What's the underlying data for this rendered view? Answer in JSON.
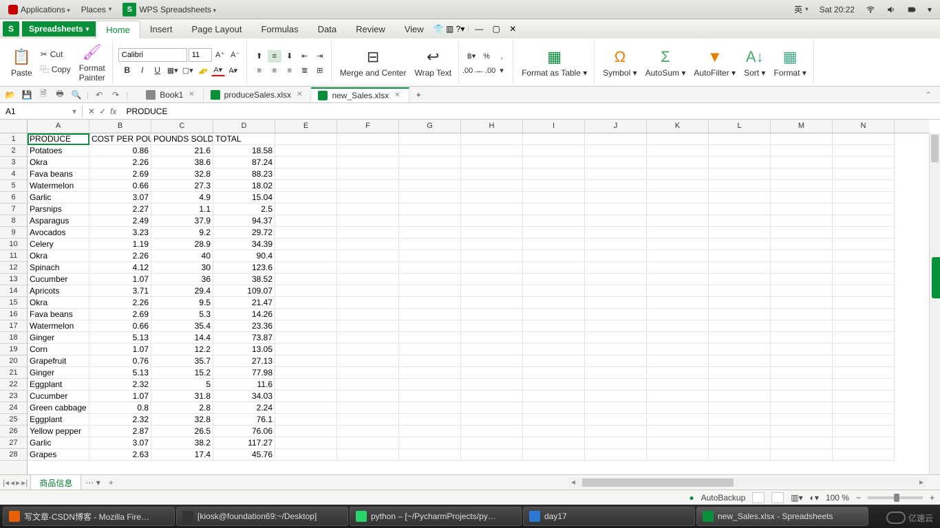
{
  "gnome": {
    "applications": "Applications",
    "places": "Places",
    "wps": "WPS Spreadsheets",
    "ime": "英",
    "clock": "Sat 20:22"
  },
  "app": {
    "title": "Spreadsheets"
  },
  "ribbon_tabs": [
    "Home",
    "Insert",
    "Page Layout",
    "Formulas",
    "Data",
    "Review",
    "View"
  ],
  "ribbon": {
    "paste": "Paste",
    "cut": "Cut",
    "copy": "Copy",
    "format_painter": "Format\nPainter",
    "font_name": "Calibri",
    "font_size": "11",
    "merge": "Merge and Center",
    "wrap": "Wrap Text",
    "format_table": "Format as Table",
    "symbol": "Symbol",
    "autosum": "AutoSum",
    "autofilter": "AutoFilter",
    "sort": "Sort",
    "format": "Format"
  },
  "doc_tabs": [
    {
      "label": "Book1",
      "active": false
    },
    {
      "label": "produceSales.xlsx",
      "active": false
    },
    {
      "label": "new_Sales.xlsx",
      "active": true
    }
  ],
  "namebox": "A1",
  "formula": "PRODUCE",
  "columns": [
    "A",
    "B",
    "C",
    "D",
    "E",
    "F",
    "G",
    "H",
    "I",
    "J",
    "K",
    "L",
    "M",
    "N"
  ],
  "rows": [
    [
      "PRODUCE",
      "COST PER POUND",
      "POUNDS SOLD",
      "TOTAL"
    ],
    [
      "Potatoes",
      "0.86",
      "21.6",
      "18.58"
    ],
    [
      "Okra",
      "2.26",
      "38.6",
      "87.24"
    ],
    [
      "Fava beans",
      "2.69",
      "32.8",
      "88.23"
    ],
    [
      "Watermelon",
      "0.66",
      "27.3",
      "18.02"
    ],
    [
      "Garlic",
      "3.07",
      "4.9",
      "15.04"
    ],
    [
      "Parsnips",
      "2.27",
      "1.1",
      "2.5"
    ],
    [
      "Asparagus",
      "2.49",
      "37.9",
      "94.37"
    ],
    [
      "Avocados",
      "3.23",
      "9.2",
      "29.72"
    ],
    [
      "Celery",
      "1.19",
      "28.9",
      "34.39"
    ],
    [
      "Okra",
      "2.26",
      "40",
      "90.4"
    ],
    [
      "Spinach",
      "4.12",
      "30",
      "123.6"
    ],
    [
      "Cucumber",
      "1.07",
      "36",
      "38.52"
    ],
    [
      "Apricots",
      "3.71",
      "29.4",
      "109.07"
    ],
    [
      "Okra",
      "2.26",
      "9.5",
      "21.47"
    ],
    [
      "Fava beans",
      "2.69",
      "5.3",
      "14.26"
    ],
    [
      "Watermelon",
      "0.66",
      "35.4",
      "23.36"
    ],
    [
      "Ginger",
      "5.13",
      "14.4",
      "73.87"
    ],
    [
      "Corn",
      "1.07",
      "12.2",
      "13.05"
    ],
    [
      "Grapefruit",
      "0.76",
      "35.7",
      "27.13"
    ],
    [
      "Ginger",
      "5.13",
      "15.2",
      "77.98"
    ],
    [
      "Eggplant",
      "2.32",
      "5",
      "11.6"
    ],
    [
      "Cucumber",
      "1.07",
      "31.8",
      "34.03"
    ],
    [
      "Green cabbage",
      "0.8",
      "2.8",
      "2.24"
    ],
    [
      "Eggplant",
      "2.32",
      "32.8",
      "76.1"
    ],
    [
      "Yellow pepper",
      "2.87",
      "26.5",
      "76.06"
    ],
    [
      "Garlic",
      "3.07",
      "38.2",
      "117.27"
    ],
    [
      "Grapes",
      "2.63",
      "17.4",
      "45.76"
    ]
  ],
  "sheet_tab": "商品信息",
  "status": {
    "autobackup": "AutoBackup",
    "zoom": "100 %"
  },
  "taskbar": [
    {
      "label": "写文章-CSDN博客 - Mozilla Fire…",
      "color": "#e66000"
    },
    {
      "label": "[kiosk@foundation69:~/Desktop]",
      "color": "#333"
    },
    {
      "label": "python – [~/PycharmProjects/py…",
      "color": "#2bd46b"
    },
    {
      "label": "day17",
      "color": "#2b78d4"
    },
    {
      "label": "new_Sales.xlsx - Spreadsheets",
      "color": "#0a8f3a",
      "active": true
    }
  ],
  "watermark": "亿速云"
}
